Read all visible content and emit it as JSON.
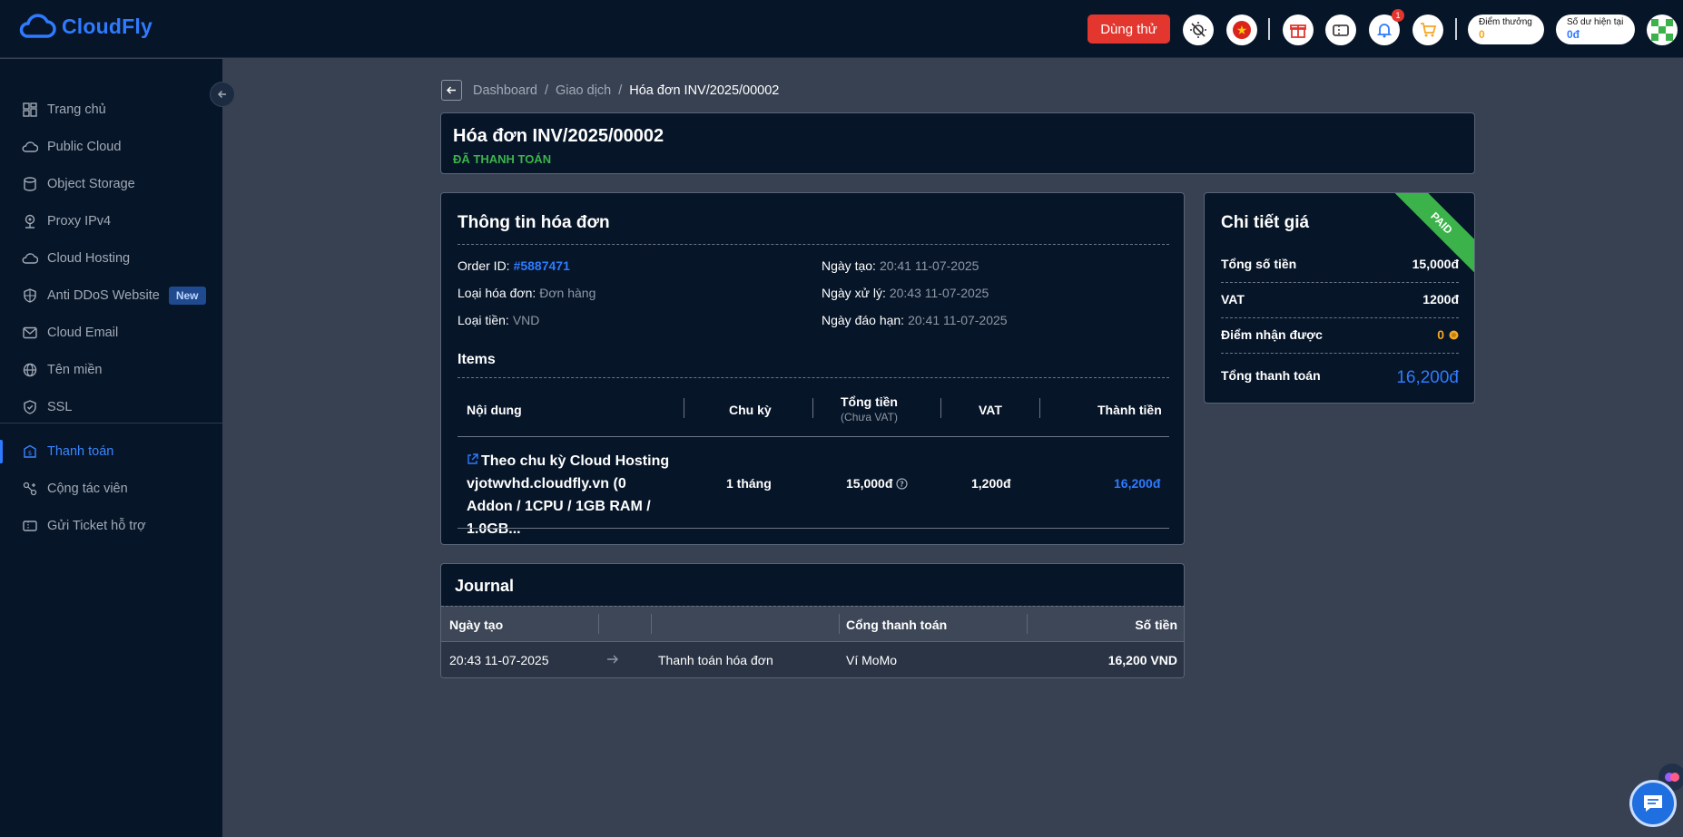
{
  "app": {
    "brand": "CloudFly"
  },
  "header": {
    "trial_label": "Dùng thử",
    "notification_count": "1",
    "reward_points": {
      "label": "Điểm thưởng",
      "value": "0"
    },
    "balance": {
      "label": "Số dư hiện tại",
      "value": "0đ"
    }
  },
  "sidebar": {
    "items": [
      {
        "label": "Trang chủ",
        "icon": "grid-icon"
      },
      {
        "label": "Public Cloud",
        "icon": "cloud-icon"
      },
      {
        "label": "Object Storage",
        "icon": "database-icon"
      },
      {
        "label": "Proxy IPv4",
        "icon": "proxy-icon"
      },
      {
        "label": "Cloud Hosting",
        "icon": "cloud-hosting-icon"
      },
      {
        "label": "Anti DDoS Website",
        "icon": "shield-icon",
        "badge": "New"
      },
      {
        "label": "Cloud Email",
        "icon": "mail-icon"
      },
      {
        "label": "Tên miền",
        "icon": "globe-icon"
      },
      {
        "label": "SSL",
        "icon": "shield-check-icon"
      },
      {
        "label": "Thanh toán",
        "icon": "billing-icon",
        "active": true
      },
      {
        "label": "Cộng tác viên",
        "icon": "affiliate-icon"
      },
      {
        "label": "Gửi Ticket hỗ trợ",
        "icon": "ticket-icon"
      }
    ]
  },
  "breadcrumb": {
    "items": [
      "Dashboard",
      "Giao dịch",
      "Hóa đơn INV/2025/00002"
    ],
    "separator": "/"
  },
  "invoice": {
    "title": "Hóa đơn INV/2025/00002",
    "status": "ĐÃ THANH TOÁN"
  },
  "info": {
    "heading": "Thông tin hóa đơn",
    "order_id": {
      "label": "Order ID:",
      "value": "#5887471"
    },
    "invoice_type": {
      "label": "Loại hóa đơn:",
      "value": "Đơn hàng"
    },
    "currency": {
      "label": "Loại tiền:",
      "value": "VND"
    },
    "created": {
      "label": "Ngày tạo:",
      "value": "20:41 11-07-2025"
    },
    "processed": {
      "label": "Ngày xử lý:",
      "value": "20:43 11-07-2025"
    },
    "due": {
      "label": "Ngày đáo hạn:",
      "value": "20:41 11-07-2025"
    },
    "items_heading": "Items",
    "table": {
      "headers": {
        "content": "Nội dung",
        "cycle": "Chu kỳ",
        "total": "Tổng tiền",
        "total_sub": "(Chưa VAT)",
        "vat": "VAT",
        "amount": "Thành tiền"
      },
      "rows": [
        {
          "content": "Theo chu kỳ Cloud Hosting vjotwvhd.cloudfly.vn (0 Addon / 1CPU / 1GB RAM / 1.0GB...",
          "cycle": "1 tháng",
          "total": "15,000đ",
          "vat": "1,200đ",
          "amount": "16,200đ"
        }
      ]
    }
  },
  "price": {
    "heading": "Chi tiết giá",
    "ribbon": "PAID",
    "subtotal": {
      "label": "Tổng số tiền",
      "value": "15,000đ"
    },
    "vat": {
      "label": "VAT",
      "value": "1200đ"
    },
    "points": {
      "label": "Điểm nhận được",
      "value": "0"
    },
    "grand_total": {
      "label": "Tổng thanh toán",
      "value": "16,200đ"
    }
  },
  "journal": {
    "heading": "Journal",
    "headers": {
      "date": "Ngày tạo",
      "gateway": "Cổng thanh toán",
      "amount": "Số tiền"
    },
    "rows": [
      {
        "date": "20:43 11-07-2025",
        "description": "Thanh toán hóa đơn",
        "gateway": "Ví MoMo",
        "amount": "16,200 VND"
      }
    ]
  },
  "colors": {
    "accent": "#2f7bff",
    "success": "#3cb34a",
    "danger": "#e2362e",
    "points": "#f5a623"
  }
}
